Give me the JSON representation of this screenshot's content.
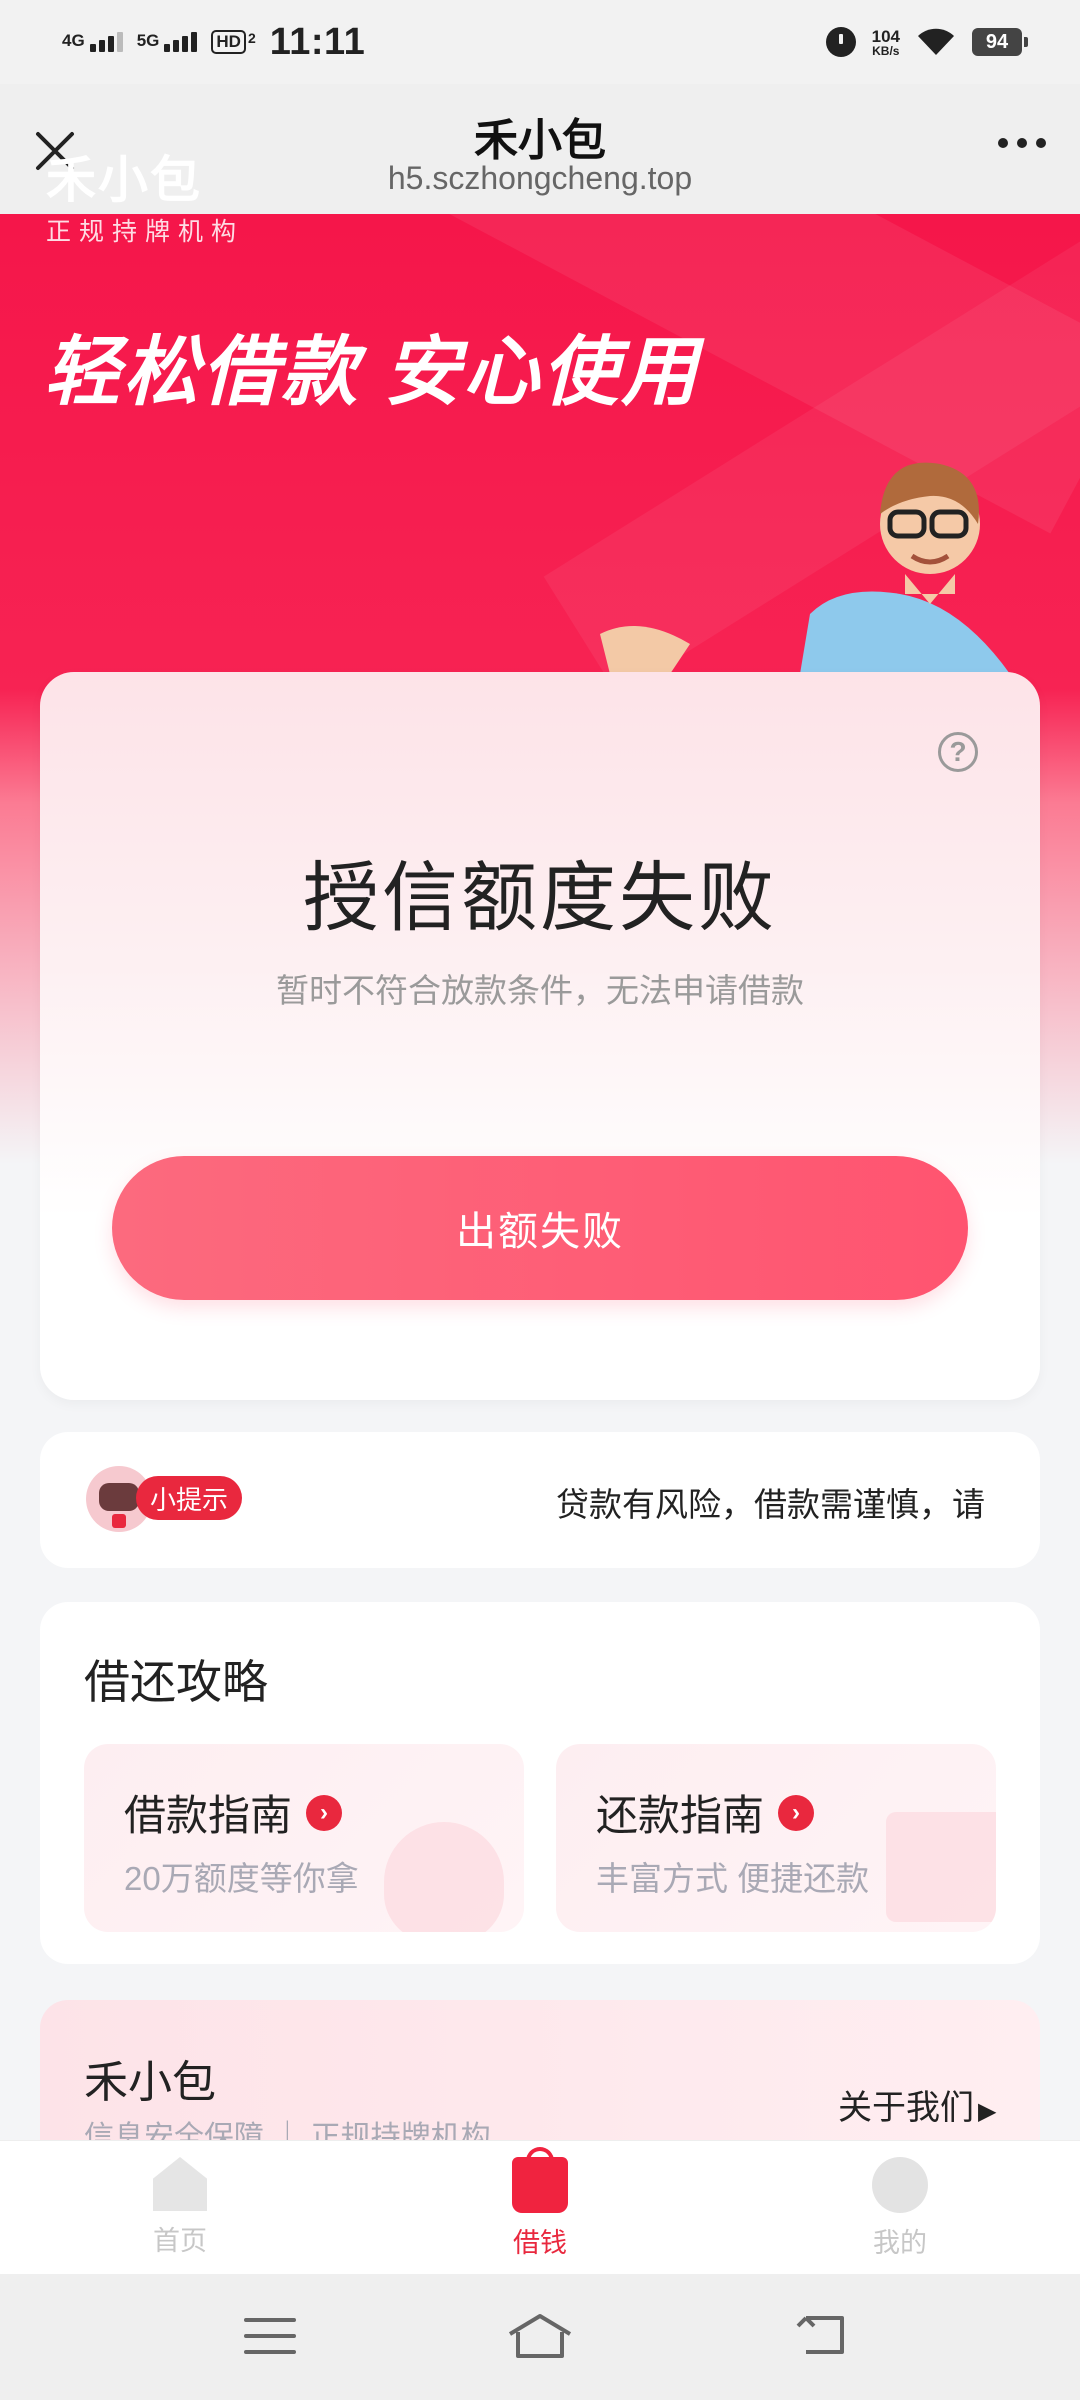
{
  "status_bar": {
    "net1": "4G",
    "net2": "5G",
    "hd": "HD",
    "hd_sub": "2",
    "time": "11:11",
    "speed_value": "104",
    "speed_unit": "KB/s",
    "battery": "94"
  },
  "header": {
    "title": "禾小包",
    "url": "h5.sczhongcheng.top"
  },
  "hero": {
    "brand": "禾小包",
    "brand_sub": "正规持牌机构",
    "slogan": "轻松借款  安心使用"
  },
  "result_card": {
    "help_icon_glyph": "?",
    "title": "授信额度失败",
    "subtitle": "暂时不符合放款条件，无法申请借款",
    "button_label": "出额失败"
  },
  "tip": {
    "badge": "小提示",
    "text": "贷款有风险，借款需谨慎，请"
  },
  "guide": {
    "title": "借还攻略",
    "cards": [
      {
        "title": "借款指南",
        "subtitle": "20万额度等你拿"
      },
      {
        "title": "还款指南",
        "subtitle": "丰富方式 便捷还款"
      }
    ]
  },
  "about": {
    "title": "禾小包",
    "subtitle": "信息安全保障 ｜ 正规持牌机构",
    "link": "关于我们"
  },
  "tabbar": {
    "items": [
      {
        "label": "首页",
        "icon": "home-icon"
      },
      {
        "label": "借钱",
        "icon": "shopping-bag-icon",
        "active": true
      },
      {
        "label": "我的",
        "icon": "profile-icon"
      }
    ]
  },
  "colors": {
    "brand_red": "#e9283e",
    "hero_red": "#f5164a",
    "button_pink": "#ff5470"
  }
}
